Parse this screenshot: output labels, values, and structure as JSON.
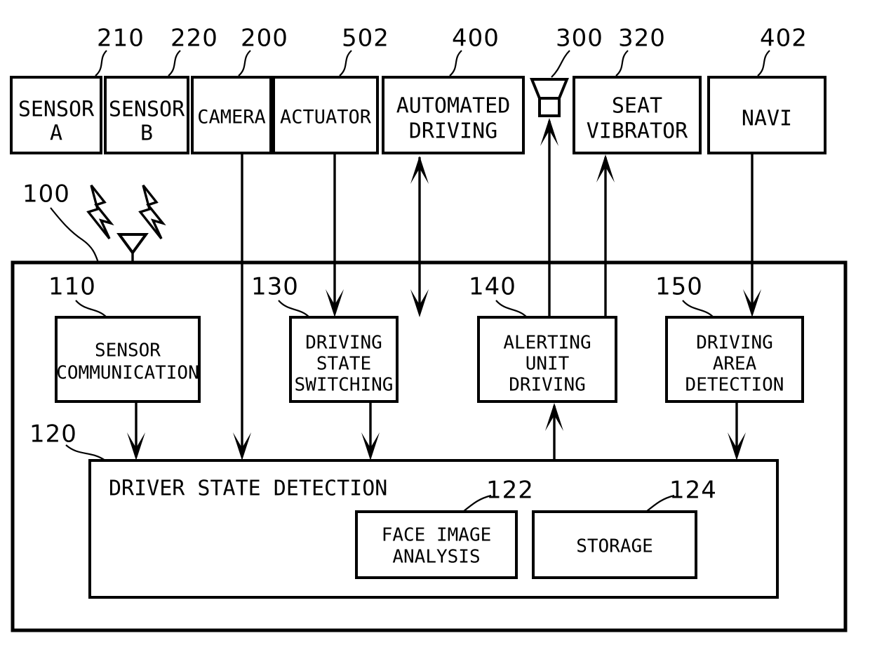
{
  "figure": {
    "type": "patent-block-diagram",
    "title": "",
    "background_color": "#ffffff",
    "line_color": "#000000"
  },
  "external_blocks": [
    {
      "id": "sensor-a",
      "label_lines": [
        "SENSOR",
        "A"
      ],
      "ref": "210"
    },
    {
      "id": "sensor-b",
      "label_lines": [
        "SENSOR",
        "B"
      ],
      "ref": "220"
    },
    {
      "id": "camera",
      "label_lines": [
        "CAMERA"
      ],
      "ref": "200"
    },
    {
      "id": "actuator",
      "label_lines": [
        "ACTUATOR"
      ],
      "ref": "502"
    },
    {
      "id": "automated-driving",
      "label_lines": [
        "AUTOMATED",
        "DRIVING"
      ],
      "ref": "400"
    },
    {
      "id": "speaker",
      "label_lines": [],
      "ref": "300"
    },
    {
      "id": "seat-vibrator",
      "label_lines": [
        "SEAT",
        "VIBRATOR"
      ],
      "ref": "320"
    },
    {
      "id": "navi",
      "label_lines": [
        "NAVI"
      ],
      "ref": "402"
    }
  ],
  "controller": {
    "ref": "100",
    "label": "",
    "units": [
      {
        "id": "sensor-communication",
        "label_lines": [
          "SENSOR",
          "COMMUNICATION"
        ],
        "ref": "110"
      },
      {
        "id": "driving-state-switching",
        "label_lines": [
          "DRIVING",
          "STATE",
          "SWITCHING"
        ],
        "ref": "130"
      },
      {
        "id": "alerting-unit-driving",
        "label_lines": [
          "ALERTING",
          "UNIT",
          "DRIVING"
        ],
        "ref": "140"
      },
      {
        "id": "driving-area-detection",
        "label_lines": [
          "DRIVING",
          "AREA",
          "DETECTION"
        ],
        "ref": "150"
      }
    ],
    "driver_state_detection": {
      "id": "driver-state-detection",
      "label": "DRIVER STATE DETECTION",
      "ref": "120",
      "sub_units": [
        {
          "id": "face-image-analysis",
          "label_lines": [
            "FACE IMAGE",
            "ANALYSIS"
          ],
          "ref": "122"
        },
        {
          "id": "storage",
          "label_lines": [
            "STORAGE"
          ],
          "ref": "124"
        }
      ]
    }
  },
  "icons": {
    "antenna": "antenna-icon",
    "speaker": "speaker-icon",
    "bolt_left": "lightning-bolt-icon",
    "bolt_right": "lightning-bolt-icon"
  },
  "text": {
    "sensor_a_l1": "SENSOR",
    "sensor_a_l2": "A",
    "sensor_b_l1": "SENSOR",
    "sensor_b_l2": "B",
    "camera": "CAMERA",
    "actuator": "ACTUATOR",
    "auto_l1": "AUTOMATED",
    "auto_l2": "DRIVING",
    "seat_l1": "SEAT",
    "seat_l2": "VIBRATOR",
    "navi": "NAVI",
    "sc_l1": "SENSOR",
    "sc_l2": "COMMUNICATION",
    "dss_l1": "DRIVING",
    "dss_l2": "STATE",
    "dss_l3": "SWITCHING",
    "aud_l1": "ALERTING",
    "aud_l2": "UNIT",
    "aud_l3": "DRIVING",
    "dad_l1": "DRIVING",
    "dad_l2": "AREA",
    "dad_l3": "DETECTION",
    "dsd": "DRIVER STATE DETECTION",
    "fia_l1": "FACE IMAGE",
    "fia_l2": "ANALYSIS",
    "storage": "STORAGE"
  },
  "ref_numbers": {
    "r210": "210",
    "r220": "220",
    "r200": "200",
    "r502": "502",
    "r400": "400",
    "r300": "300",
    "r320": "320",
    "r402": "402",
    "r100": "100",
    "r110": "110",
    "r130": "130",
    "r140": "140",
    "r150": "150",
    "r120": "120",
    "r122": "122",
    "r124": "124"
  }
}
